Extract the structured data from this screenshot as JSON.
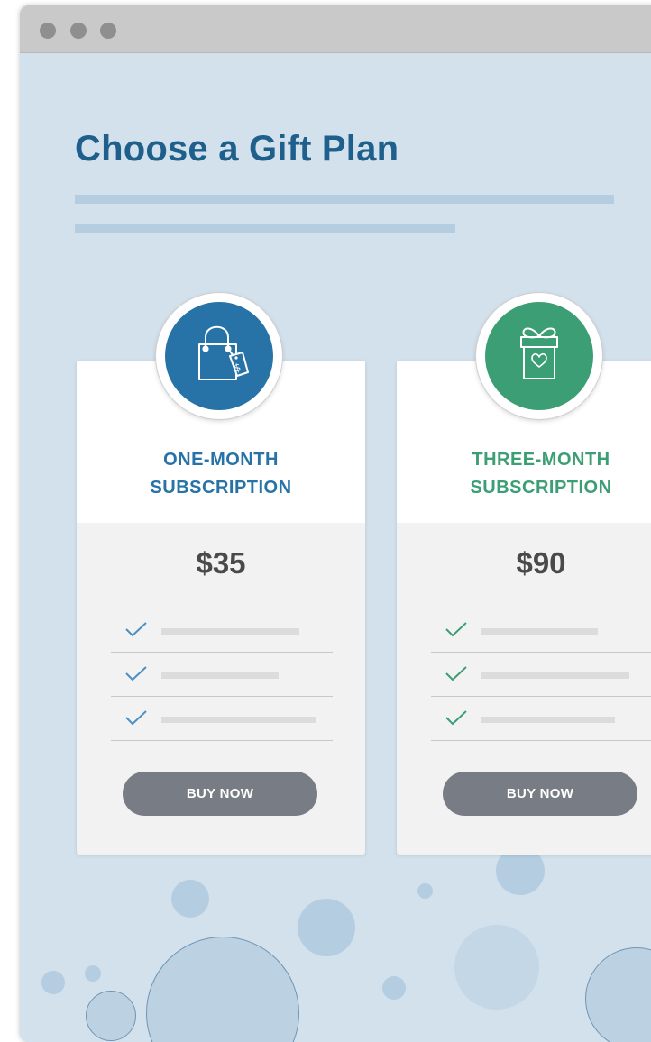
{
  "page": {
    "title": "Choose a Gift Plan"
  },
  "colors": {
    "blue_accent": "#2773a8",
    "green_accent": "#3c9e74",
    "button_gray": "#787c84",
    "background": "#d3e1ec"
  },
  "plans": [
    {
      "name_line1": "ONE-MONTH",
      "name_line2": "SUBSCRIPTION",
      "price": "$35",
      "icon": "shopping-bag-icon",
      "button_label": "BUY NOW"
    },
    {
      "name_line1": "THREE-MONTH",
      "name_line2": "SUBSCRIPTION",
      "price": "$90",
      "icon": "gift-box-icon",
      "button_label": "BUY NOW"
    }
  ]
}
